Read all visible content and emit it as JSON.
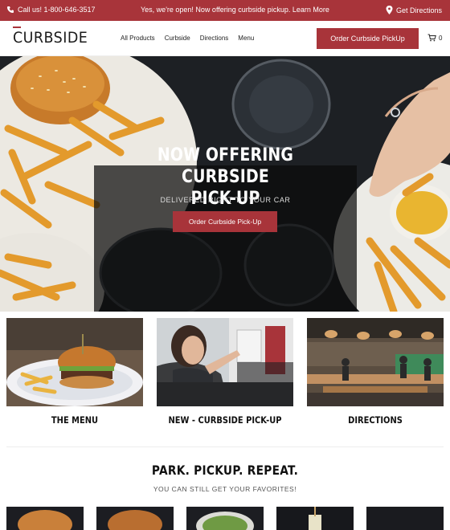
{
  "topbar": {
    "phone": "Call us! 1-800-646-3517",
    "announcement": "Yes, we're open! Now offering curbside pickup. Learn More",
    "directions": "Get Directions",
    "icons": [
      "phone-icon",
      "map-pin-icon"
    ]
  },
  "header": {
    "logo": "CURBSIDE",
    "nav": [
      "All Products",
      "Curbside",
      "Directions",
      "Menu"
    ],
    "cta": "Order Curbside PickUp",
    "cart_count": "0"
  },
  "hero": {
    "title_line1": "NOW OFFERING CURBSIDE",
    "title_line2": "PICK-UP",
    "subtitle": "DELIVERED RIGHT TO YOUR CAR",
    "button": "Order Curbside Pick-Up"
  },
  "cards": [
    {
      "title": "THE MENU"
    },
    {
      "title": "NEW - CURBSIDE PICK-UP"
    },
    {
      "title": "DIRECTIONS"
    }
  ],
  "section": {
    "title": "PARK. PICKUP. REPEAT.",
    "subtitle": "YOU CAN STILL GET YOUR FAVORITES!"
  },
  "colors": {
    "brand": "#a8343a",
    "hero_bg": "#1a1d21"
  }
}
